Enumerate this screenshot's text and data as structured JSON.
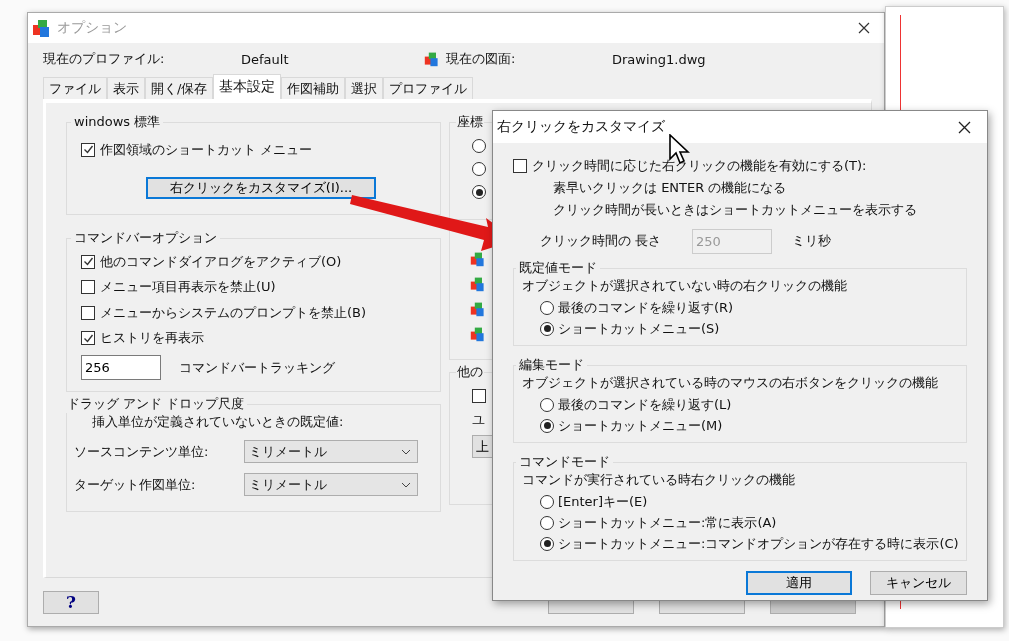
{
  "window": {
    "title": "オプション"
  },
  "profile": {
    "label": "現在のプロファイル:",
    "value": "Default"
  },
  "drawing": {
    "label": "現在の図面:",
    "value": "Drawing1.dwg"
  },
  "tabs": [
    {
      "label": "ファイル",
      "selected": false
    },
    {
      "label": "表示",
      "selected": false
    },
    {
      "label": "開く/保存",
      "selected": false
    },
    {
      "label": "基本設定",
      "selected": true
    },
    {
      "label": "作図補助",
      "selected": false
    },
    {
      "label": "選択",
      "selected": false
    },
    {
      "label": "プロファイル",
      "selected": false
    }
  ],
  "windows_group": {
    "title": "windows 標準",
    "checkbox": {
      "label": "作図領域のショートカット メニュー",
      "checked": true
    },
    "button": "右クリックをカスタマイズ(I)..."
  },
  "commandbar_group": {
    "title": "コマンドバーオプション",
    "checkboxes": [
      {
        "label": "他のコマンドダイアログをアクティブ(O)",
        "checked": true
      },
      {
        "label": "メニュー項目再表示を禁止(U)",
        "checked": false
      },
      {
        "label": "メニューからシステムのプロンプトを禁止(B)",
        "checked": false
      },
      {
        "label": "ヒストリを再表示",
        "checked": true
      }
    ],
    "tracking": {
      "value": "256",
      "label": "コマンドバートラッキング"
    }
  },
  "dragdrop_group": {
    "title": "ドラッグ アンド ドロップ尺度",
    "note": "挿入単位が定義されていないときの既定値:",
    "rows": [
      {
        "label": "ソースコンテンツ単位:",
        "value": "ミリメートル"
      },
      {
        "label": "ターゲット作図単位:",
        "value": "ミリメートル"
      }
    ]
  },
  "right_column": {
    "coord_title": "座標",
    "coord_radios": [
      {
        "selected": false
      },
      {
        "selected": false
      },
      {
        "selected": true
      }
    ],
    "other_title": "他の",
    "other_checkbox": {
      "checked": false
    },
    "other_label": "ユ",
    "other_button": "上"
  },
  "help_button": "?",
  "footer_buttons": [
    {
      "disabled": false
    },
    {
      "disabled": false
    },
    {
      "disabled": true
    }
  ],
  "dialog": {
    "title": "右クリックをカスタマイズ",
    "timed": {
      "label": "クリック時間に応じた右クリックの機能を有効にする(T):",
      "checked": false
    },
    "notes": [
      "素早いクリックは ENTER の機能になる",
      "クリック時間が長いときはショートカットメニューを表示する"
    ],
    "duration": {
      "label": "クリック時間の 長さ",
      "value": "250",
      "unit": "ミリ秒",
      "disabled": true
    },
    "groups": [
      {
        "title": "既定値モード",
        "description": "オブジェクトが選択されていない時の右クリックの機能",
        "options": [
          {
            "label": "最後のコマンドを繰り返す(R)",
            "selected": false
          },
          {
            "label": "ショートカットメニュー(S)",
            "selected": true
          }
        ]
      },
      {
        "title": "編集モード",
        "description": "オブジェクトが選択されている時のマウスの右ボタンをクリックの機能",
        "options": [
          {
            "label": "最後のコマンドを繰り返す(L)",
            "selected": false
          },
          {
            "label": "ショートカットメニュー(M)",
            "selected": true
          }
        ]
      },
      {
        "title": "コマンドモード",
        "description": "コマンドが実行されている時右クリックの機能",
        "options": [
          {
            "label": "[Enter]キー(E)",
            "selected": false
          },
          {
            "label": "ショートカットメニュー:常に表示(A)",
            "selected": false
          },
          {
            "label": "ショートカットメニュー:コマンドオプションが存在する時に表示(C)",
            "selected": true
          }
        ]
      }
    ],
    "buttons": [
      {
        "label": "適用",
        "default": true
      },
      {
        "label": "キャンセル",
        "default": false
      }
    ]
  }
}
